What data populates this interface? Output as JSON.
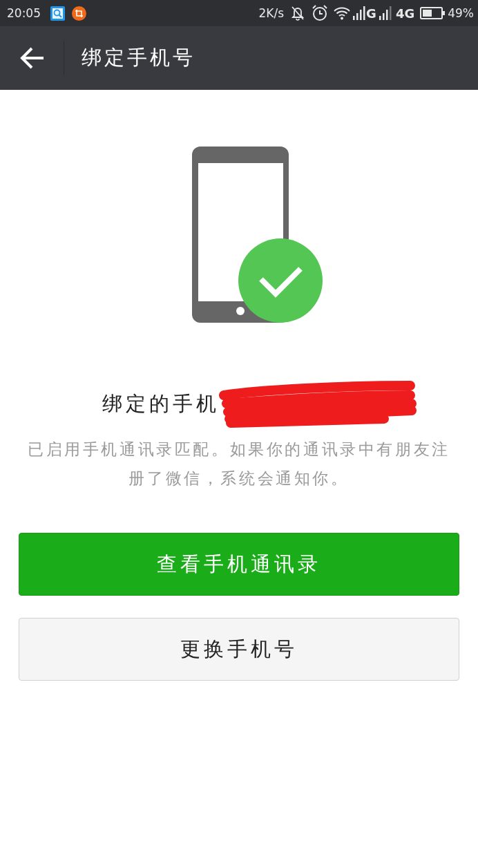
{
  "status_bar": {
    "time": "20:05",
    "speed": "2K/s",
    "network_1": "G",
    "network_2": "4G",
    "battery": "49%"
  },
  "header": {
    "title": "绑定手机号"
  },
  "bound_phone": {
    "label": "绑定的手机"
  },
  "description": "已启用手机通讯录匹配。如果你的通讯录中有朋友注册了微信，系统会通知你。",
  "buttons": [
    {
      "label": "查看手机通讯录",
      "kind": "primary"
    },
    {
      "label": "更换手机号",
      "kind": "secondary"
    }
  ]
}
